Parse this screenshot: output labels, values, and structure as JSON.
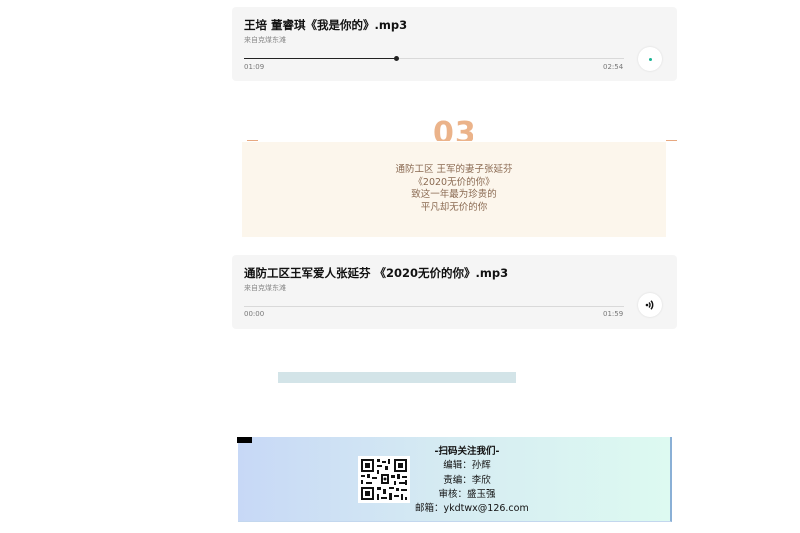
{
  "players": [
    {
      "title": "王培 董睿琪《我是你的》.mp3",
      "source": "来自克煤东滩",
      "current_time": "01:09",
      "duration": "02:54",
      "progress": 0.4,
      "state_icon": "loading-dot-icon"
    },
    {
      "title": "通防工区王军爱人张延芬 《2020无价的你》.mp3",
      "source": "来自克煤东滩",
      "current_time": "00:00",
      "duration": "01:59",
      "progress": 0.0,
      "state_icon": "speaker-icon"
    }
  ],
  "section": {
    "number": "03",
    "lines": [
      "通防工区 王军的妻子张延芬",
      "《2020无价的你》",
      "致这一年最为珍贵的",
      "平凡却无价的你"
    ]
  },
  "footer": {
    "heading": "-扫码关注我们-",
    "editor": "编辑：孙辉",
    "responsible_editor": "责编：李欣",
    "reviewer": "审核：盛玉强",
    "email": "邮箱：ykdtwx@126.com"
  },
  "colors": {
    "accent_orange": "#ebb38a",
    "quote_bg": "#fcf6ec",
    "player_bg": "#f5f5f5",
    "loading_dot": "#19b394"
  }
}
